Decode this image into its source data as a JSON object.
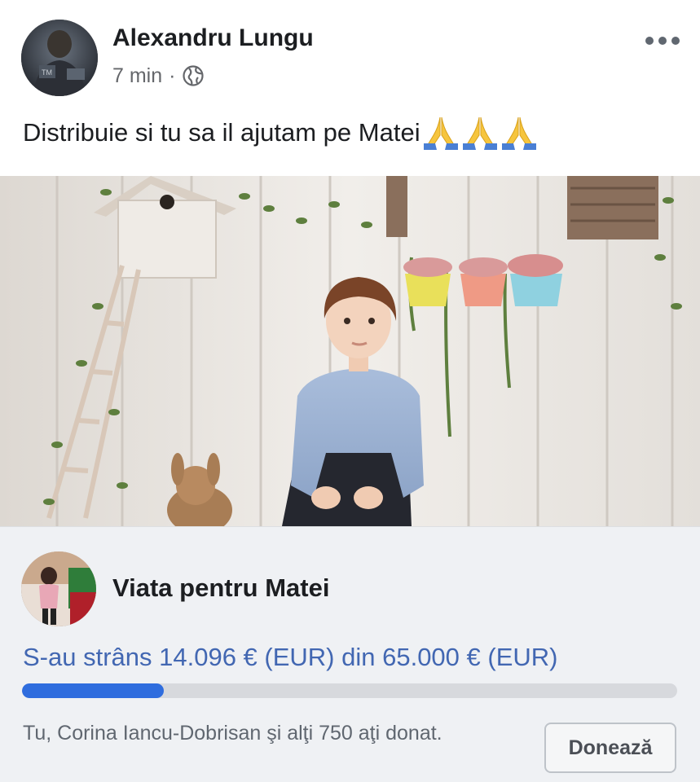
{
  "post": {
    "author_name": "Alexandru Lungu",
    "time": "7 min",
    "separator": "·",
    "audience_icon": "globe-icon",
    "more_icon": "more-options-icon",
    "text": "Distribuie si tu sa il ajutam pe Matei",
    "emoji_icon": "folded-hands-emoji"
  },
  "fundraiser": {
    "title": "Viata pentru Matei",
    "raised_text": "S-au strâns 14.096 € (EUR) din 65.000 € (EUR)",
    "raised_amount": 14096,
    "goal_amount": 65000,
    "progress_fraction": 0.217,
    "donors_text": "Tu, Corina Iancu-Dobrisan şi alţi 750 aţi donat.",
    "donate_label": "Donează"
  },
  "colors": {
    "link_blue": "#4267b2",
    "progress_blue": "#2f6dde",
    "card_bg": "#eff1f4"
  }
}
